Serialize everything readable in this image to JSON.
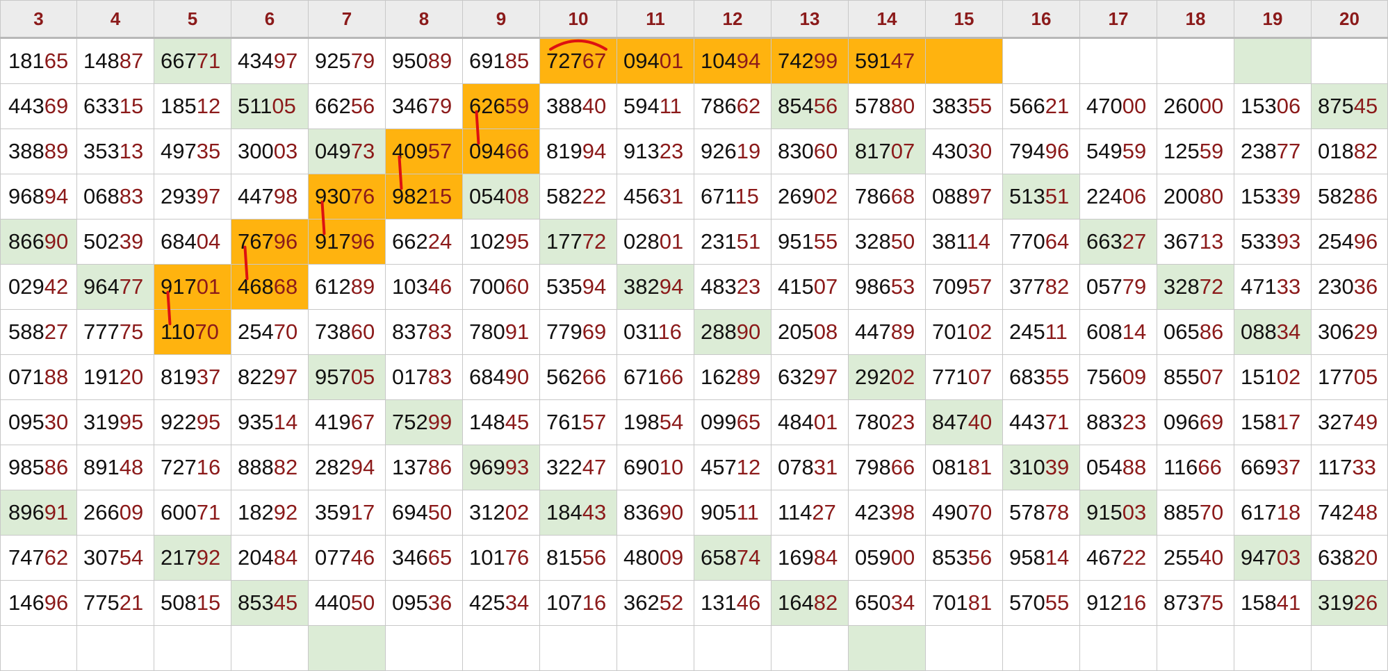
{
  "columns": [
    "3",
    "4",
    "5",
    "6",
    "7",
    "8",
    "9",
    "10",
    "11",
    "12",
    "13",
    "14",
    "15",
    "16",
    "17",
    "18",
    "19",
    "20"
  ],
  "rows": [
    [
      "18165",
      "14887",
      "66771",
      "43497",
      "92579",
      "95089",
      "69185",
      "72767",
      "09401",
      "10494",
      "74299",
      "59147",
      "",
      "",
      "",
      "",
      "",
      ""
    ],
    [
      "44369",
      "63315",
      "18512",
      "51105",
      "66256",
      "34679",
      "62659",
      "38840",
      "59411",
      "78662",
      "85456",
      "57880",
      "38355",
      "56621",
      "47000",
      "26000",
      "15306",
      "87545"
    ],
    [
      "38889",
      "35313",
      "49735",
      "30003",
      "04973",
      "40957",
      "09466",
      "81994",
      "91323",
      "92619",
      "83060",
      "81707",
      "43030",
      "79496",
      "54959",
      "12559",
      "23877",
      "01882"
    ],
    [
      "96894",
      "06883",
      "29397",
      "44798",
      "93076",
      "98215",
      "05408",
      "58222",
      "45631",
      "67115",
      "26902",
      "78668",
      "08897",
      "51351",
      "22406",
      "20080",
      "15339",
      "58286"
    ],
    [
      "86690",
      "50239",
      "68404",
      "76796",
      "91796",
      "66224",
      "10295",
      "17772",
      "02801",
      "23151",
      "95155",
      "32850",
      "38114",
      "77064",
      "66327",
      "36713",
      "53393",
      "25496"
    ],
    [
      "02942",
      "96477",
      "91701",
      "46868",
      "61289",
      "10346",
      "70060",
      "53594",
      "38294",
      "48323",
      "41507",
      "98653",
      "70957",
      "37782",
      "05779",
      "32872",
      "47133",
      "23036"
    ],
    [
      "58827",
      "77775",
      "11070",
      "25470",
      "73860",
      "83783",
      "78091",
      "77969",
      "03116",
      "28890",
      "20508",
      "44789",
      "70102",
      "24511",
      "60814",
      "06586",
      "08834",
      "30629"
    ],
    [
      "07188",
      "19120",
      "81937",
      "82297",
      "95705",
      "01783",
      "68490",
      "56266",
      "67166",
      "16289",
      "63297",
      "29202",
      "77107",
      "68355",
      "75609",
      "85507",
      "15102",
      "17705"
    ],
    [
      "09530",
      "31995",
      "92295",
      "93514",
      "41967",
      "75299",
      "14845",
      "76157",
      "19854",
      "09965",
      "48401",
      "78023",
      "84740",
      "44371",
      "88323",
      "09669",
      "15817",
      "32749"
    ],
    [
      "98586",
      "89148",
      "72716",
      "88882",
      "28294",
      "13786",
      "96993",
      "32247",
      "69010",
      "45712",
      "07831",
      "79866",
      "08181",
      "31039",
      "05488",
      "11666",
      "66937",
      "11733"
    ],
    [
      "89691",
      "26609",
      "60071",
      "18292",
      "35917",
      "69450",
      "31202",
      "18443",
      "83690",
      "90511",
      "11427",
      "42398",
      "49070",
      "57878",
      "91503",
      "88570",
      "61718",
      "74248"
    ],
    [
      "74762",
      "30754",
      "21792",
      "20484",
      "07746",
      "34665",
      "10176",
      "81556",
      "48009",
      "65874",
      "16984",
      "05900",
      "85356",
      "95814",
      "46722",
      "25540",
      "94703",
      "63820"
    ],
    [
      "14696",
      "77521",
      "50815",
      "85345",
      "44050",
      "09536",
      "42534",
      "10716",
      "36252",
      "13146",
      "16482",
      "65034",
      "70181",
      "57055",
      "91216",
      "87375",
      "15841",
      "31926"
    ],
    [
      "",
      "",
      "",
      "",
      "",
      "",
      "",
      "",
      "",
      "",
      "",
      "",
      "",
      "",
      "",
      "",
      "",
      ""
    ]
  ],
  "highlights": {
    "green": [
      [
        0,
        2
      ],
      [
        0,
        16
      ],
      [
        1,
        3
      ],
      [
        1,
        10
      ],
      [
        1,
        17
      ],
      [
        2,
        4
      ],
      [
        2,
        11
      ],
      [
        3,
        6
      ],
      [
        3,
        13
      ],
      [
        4,
        0
      ],
      [
        4,
        7
      ],
      [
        4,
        14
      ],
      [
        5,
        1
      ],
      [
        5,
        8
      ],
      [
        5,
        15
      ],
      [
        6,
        9
      ],
      [
        6,
        16
      ],
      [
        7,
        4
      ],
      [
        7,
        11
      ],
      [
        8,
        5
      ],
      [
        8,
        12
      ],
      [
        9,
        6
      ],
      [
        9,
        13
      ],
      [
        10,
        0
      ],
      [
        10,
        7
      ],
      [
        10,
        14
      ],
      [
        11,
        2
      ],
      [
        11,
        9
      ],
      [
        11,
        16
      ],
      [
        12,
        3
      ],
      [
        12,
        10
      ],
      [
        12,
        17
      ],
      [
        13,
        4
      ],
      [
        13,
        11
      ]
    ],
    "orange": [
      [
        0,
        7
      ],
      [
        0,
        8
      ],
      [
        0,
        9
      ],
      [
        0,
        10
      ],
      [
        0,
        11
      ],
      [
        0,
        12
      ],
      [
        1,
        6
      ],
      [
        2,
        5
      ],
      [
        2,
        6
      ],
      [
        3,
        4
      ],
      [
        3,
        5
      ],
      [
        4,
        3
      ],
      [
        4,
        4
      ],
      [
        5,
        2
      ],
      [
        5,
        3
      ],
      [
        6,
        2
      ]
    ],
    "colors": {
      "green": "#dcecd6",
      "orange": "#ffb30f",
      "header_bg": "#ececec",
      "header_text": "#8b1a1a",
      "digit_suffix": "#8b1a1a",
      "digit_prefix": "#111111",
      "mark_line": "#dd1111"
    }
  },
  "marks": {
    "arc": [
      0,
      7
    ],
    "vertical_links": [
      [
        [
          1,
          6
        ],
        [
          2,
          6
        ]
      ],
      [
        [
          2,
          5
        ],
        [
          3,
          5
        ]
      ],
      [
        [
          3,
          4
        ],
        [
          4,
          4
        ]
      ],
      [
        [
          4,
          3
        ],
        [
          5,
          3
        ]
      ],
      [
        [
          5,
          2
        ],
        [
          6,
          2
        ]
      ]
    ]
  }
}
